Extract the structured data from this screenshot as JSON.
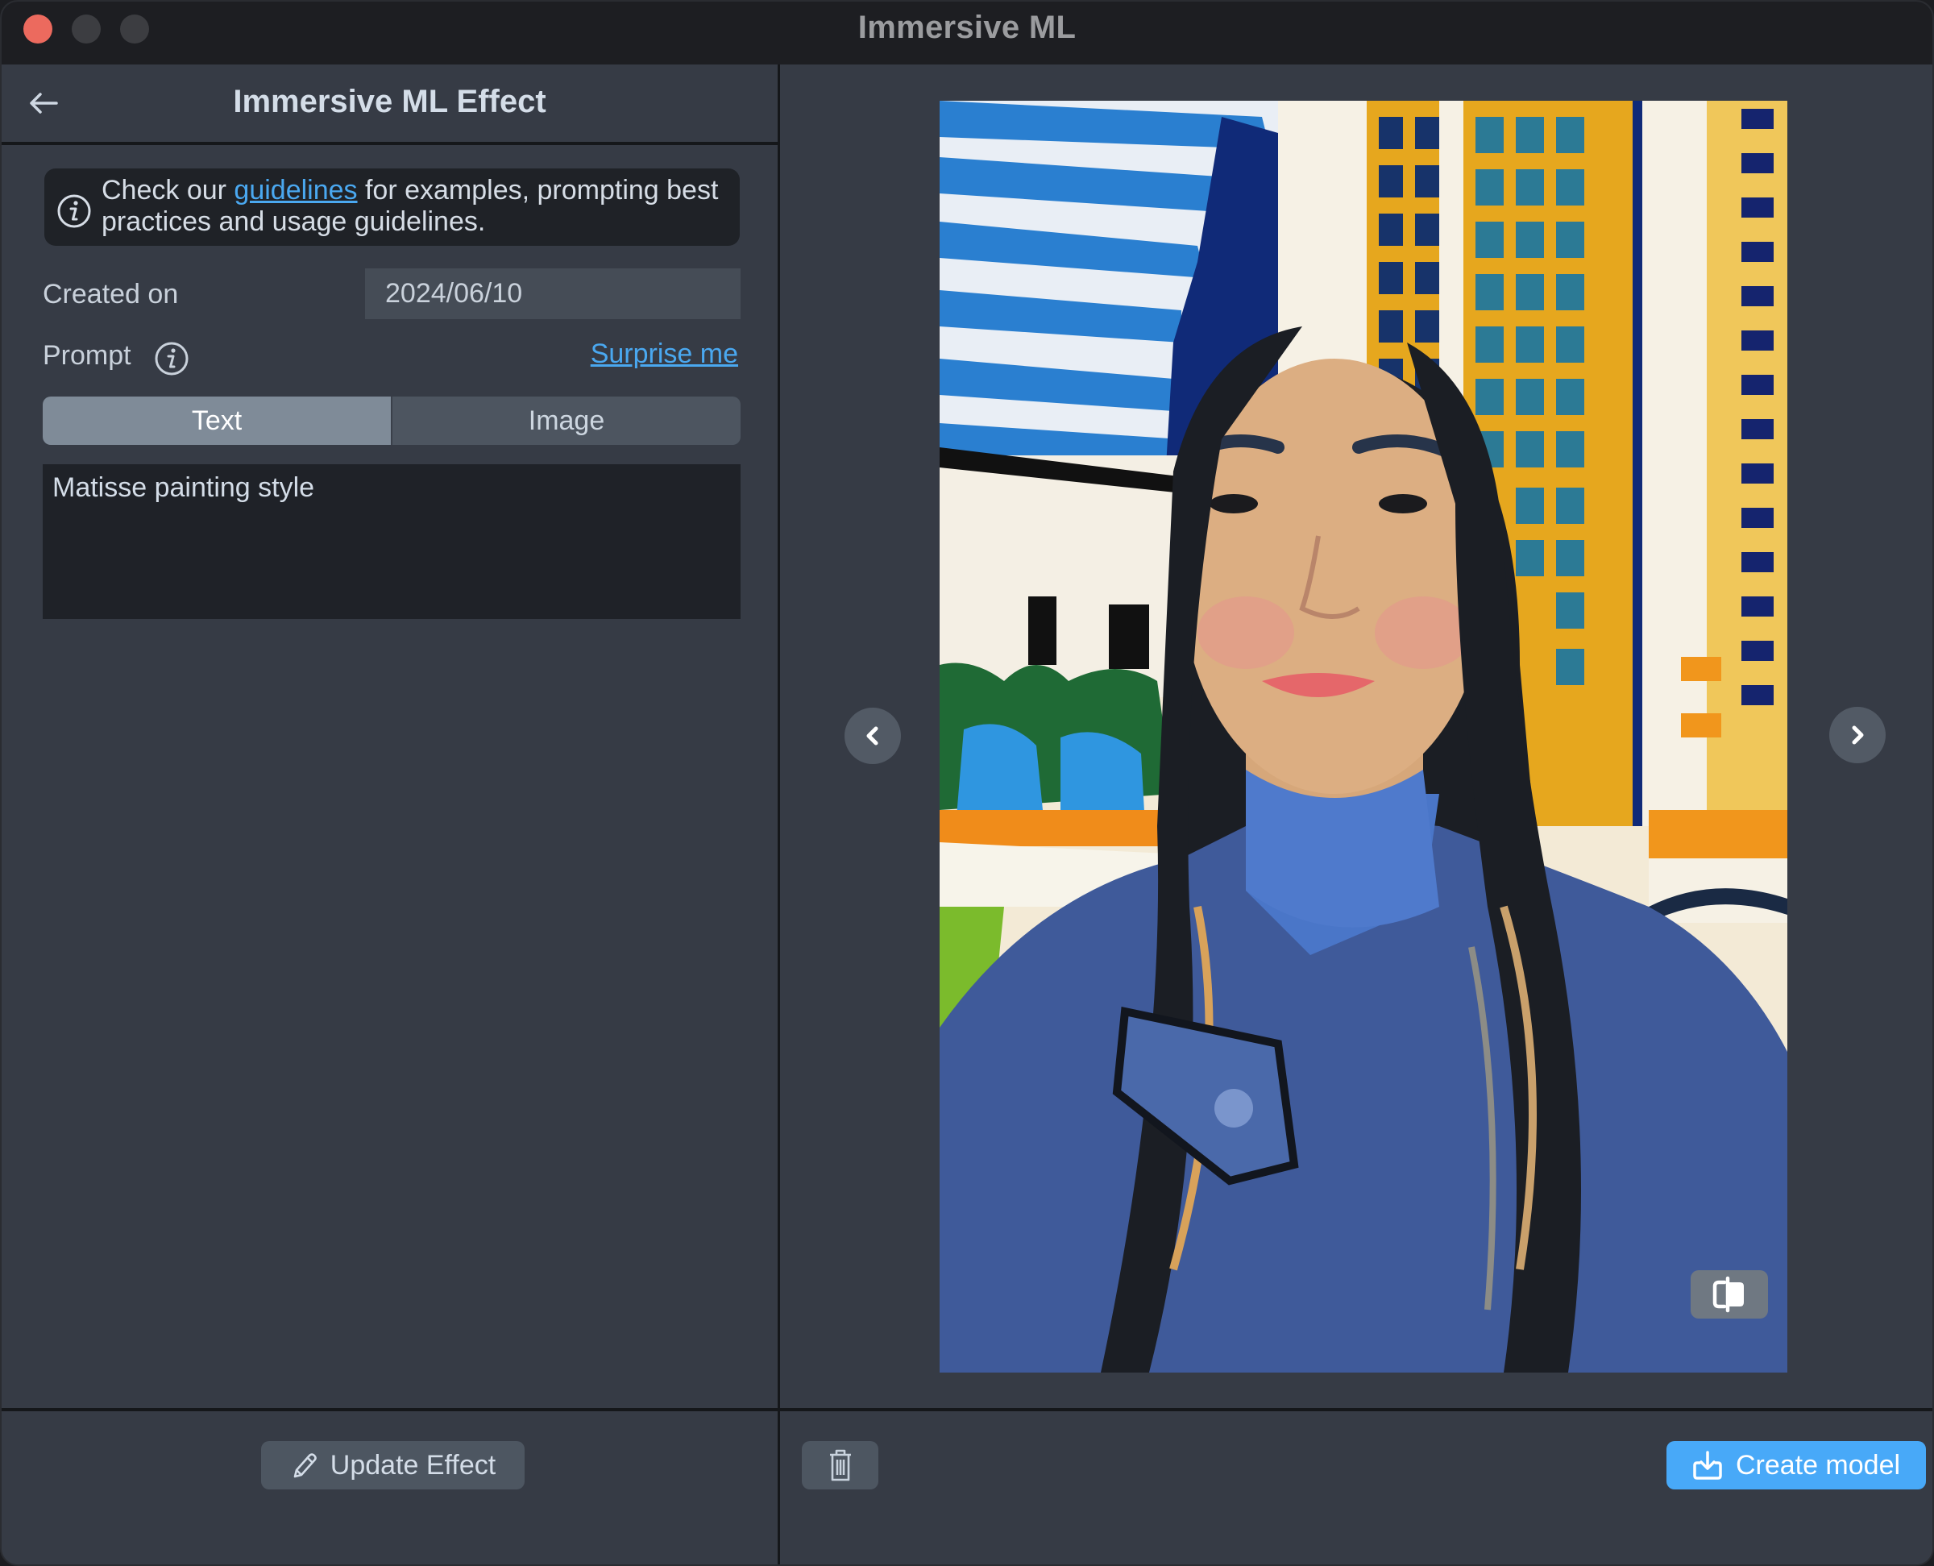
{
  "window": {
    "title": "Immersive ML",
    "traffic_lights": [
      "close",
      "minimize",
      "maximize"
    ]
  },
  "left_panel": {
    "header": {
      "back_icon": "arrow-left-icon",
      "title": "Immersive ML Effect"
    },
    "info_box": {
      "icon": "info-icon",
      "text_before": "Check our ",
      "link_text": "guidelines",
      "text_after": " for examples, prompting best practices and usage guidelines."
    },
    "created_on": {
      "label": "Created on",
      "value": "2024/06/10"
    },
    "prompt": {
      "label": "Prompt",
      "info_icon": "info-icon",
      "surprise_link": "Surprise me",
      "tabs": [
        {
          "label": "Text",
          "active": true
        },
        {
          "label": "Image",
          "active": false
        }
      ],
      "value": "Matisse painting style"
    },
    "footer": {
      "update_button": "Update Effect",
      "update_icon": "pencil-icon"
    }
  },
  "right_panel": {
    "preview": {
      "description": "Matisse-style painted portrait of a woman with long dark hair in a blue jacket in front of colorful buildings",
      "prev_icon": "chevron-left-icon",
      "next_icon": "chevron-right-icon",
      "compare_icon": "compare-split-icon"
    },
    "footer": {
      "delete_icon": "trash-icon",
      "create_button": "Create model",
      "create_icon": "download-tray-icon"
    }
  },
  "colors": {
    "accent": "#48a9f8",
    "link": "#4aa8f0",
    "close_light": "#ec6a5e",
    "panel_bg": "#363b45",
    "titlebar_bg": "#1d1e22"
  }
}
